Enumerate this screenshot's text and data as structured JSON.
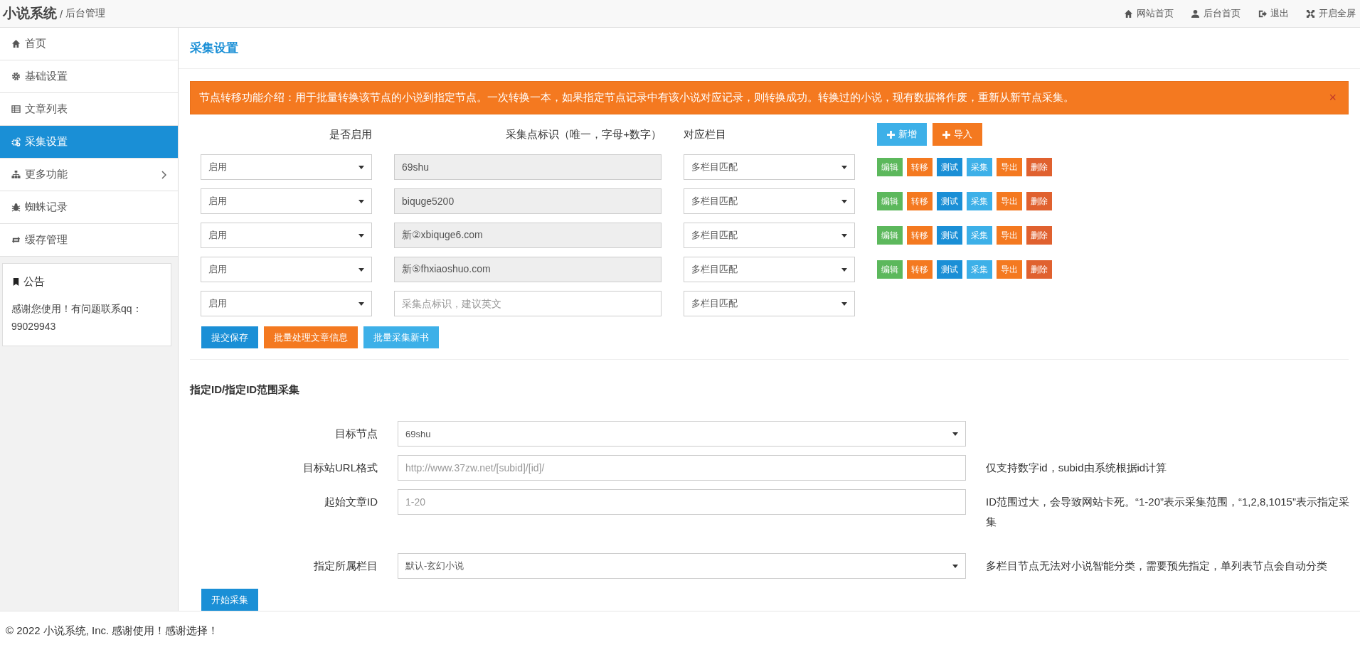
{
  "topbar": {
    "brand": "小说系统",
    "separator": "/",
    "subtitle": "后台管理",
    "links": [
      {
        "label": "网站首页"
      },
      {
        "label": "后台首页"
      },
      {
        "label": "退出"
      },
      {
        "label": "开启全屏"
      }
    ]
  },
  "sidebar": {
    "items": [
      {
        "label": "首页",
        "selected": false,
        "has_submenu": false
      },
      {
        "label": "基础设置",
        "selected": false,
        "has_submenu": false
      },
      {
        "label": "文章列表",
        "selected": false,
        "has_submenu": false
      },
      {
        "label": "采集设置",
        "selected": true,
        "has_submenu": false
      },
      {
        "label": "更多功能",
        "selected": false,
        "has_submenu": true
      },
      {
        "label": "蜘蛛记录",
        "selected": false,
        "has_submenu": false
      },
      {
        "label": "缓存管理",
        "selected": false,
        "has_submenu": false
      }
    ],
    "notice": {
      "title": "公告",
      "text": "感谢您使用！有问题联系qq：99029943"
    }
  },
  "page_title": "采集设置",
  "alert": {
    "text": "节点转移功能介绍：用于批量转换该节点的小说到指定节点。一次转换一本，如果指定节点记录中有该小说对应记录，则转换成功。转换过的小说，现有数据将作废，重新从新节点采集。",
    "close": "×"
  },
  "table": {
    "columns": [
      "是否启用",
      "采集点标识（唯一，字母+数字）",
      "对应栏目"
    ],
    "header_buttons": [
      {
        "label": "新增",
        "color": "#3db0e8"
      },
      {
        "label": "导入",
        "color": "#f47920"
      }
    ],
    "rows": [
      {
        "status": "启用",
        "node": "69shu",
        "readonly": true,
        "column": "多栏目匹配",
        "actions": [
          {
            "label": "编辑",
            "color": "#5cb85c"
          },
          {
            "label": "转移",
            "color": "#f47920"
          },
          {
            "label": "测试",
            "color": "#1a8fd6"
          },
          {
            "label": "采集",
            "color": "#3db0e8"
          },
          {
            "label": "导出",
            "color": "#f47920"
          },
          {
            "label": "删除",
            "color": "#e0612f"
          }
        ]
      },
      {
        "status": "启用",
        "node": "biquge5200",
        "readonly": true,
        "column": "多栏目匹配",
        "actions": [
          {
            "label": "编辑",
            "color": "#5cb85c"
          },
          {
            "label": "转移",
            "color": "#f47920"
          },
          {
            "label": "测试",
            "color": "#1a8fd6"
          },
          {
            "label": "采集",
            "color": "#3db0e8"
          },
          {
            "label": "导出",
            "color": "#f47920"
          },
          {
            "label": "删除",
            "color": "#e0612f"
          }
        ]
      },
      {
        "status": "启用",
        "node": "新②xbiquge6.com",
        "readonly": true,
        "column": "多栏目匹配",
        "actions": [
          {
            "label": "编辑",
            "color": "#5cb85c"
          },
          {
            "label": "转移",
            "color": "#f47920"
          },
          {
            "label": "测试",
            "color": "#1a8fd6"
          },
          {
            "label": "采集",
            "color": "#3db0e8"
          },
          {
            "label": "导出",
            "color": "#f47920"
          },
          {
            "label": "删除",
            "color": "#e0612f"
          }
        ]
      },
      {
        "status": "启用",
        "node": "新⑤fhxiaoshuo.com",
        "readonly": true,
        "column": "多栏目匹配",
        "actions": [
          {
            "label": "编辑",
            "color": "#5cb85c"
          },
          {
            "label": "转移",
            "color": "#f47920"
          },
          {
            "label": "测试",
            "color": "#1a8fd6"
          },
          {
            "label": "采集",
            "color": "#3db0e8"
          },
          {
            "label": "导出",
            "color": "#f47920"
          },
          {
            "label": "删除",
            "color": "#e0612f"
          }
        ]
      },
      {
        "status": "启用",
        "placeholder": "采集点标识，建议英文",
        "readonly": false,
        "column": "多栏目匹配"
      }
    ],
    "footer_buttons": [
      {
        "label": "提交保存",
        "color": "#1a8fd6"
      },
      {
        "label": "批量处理文章信息",
        "color": "#f47920"
      },
      {
        "label": "批量采集新书",
        "color": "#3db0e8"
      }
    ]
  },
  "range_section": {
    "title": "指定ID/指定ID范围采集",
    "fields": [
      {
        "label": "目标节点",
        "kind": "select",
        "value": "69shu"
      },
      {
        "label": "目标站URL格式",
        "kind": "input",
        "placeholder": "http://www.37zw.net/[subid]/[id]/",
        "help": "仅支持数字id，subid由系统根据id计算"
      },
      {
        "label": "起始文章ID",
        "kind": "input",
        "placeholder": "1-20",
        "help": "ID范围过大，会导致网站卡死。“1-20”表示采集范围，“1,2,8,1015”表示指定采集"
      },
      {
        "label": "指定所属栏目",
        "kind": "select",
        "value": "默认-玄幻小说",
        "help": "多栏目节点无法对小说智能分类，需要预先指定，单列表节点会自动分类"
      }
    ],
    "submit": "开始采集"
  },
  "footer": "© 2022 小说系统, Inc. 感谢使用！感谢选择！"
}
